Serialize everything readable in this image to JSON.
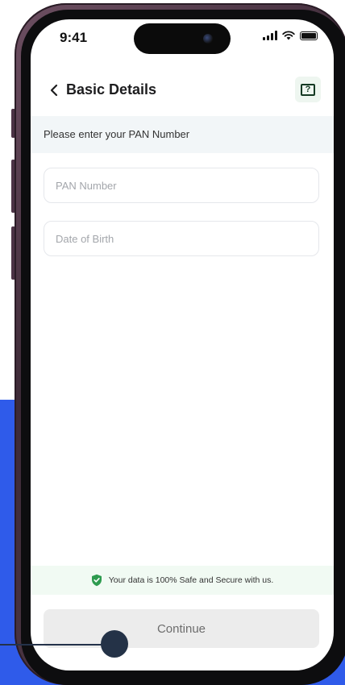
{
  "status_bar": {
    "time": "9:41"
  },
  "header": {
    "title": "Basic Details"
  },
  "form": {
    "subheading": "Please enter your PAN Number",
    "pan": {
      "placeholder": "PAN Number",
      "value": ""
    },
    "dob": {
      "placeholder": "Date of Birth",
      "value": ""
    }
  },
  "security_note": "Your data is 100% Safe and Secure with us.",
  "continue_label": "Continue",
  "colors": {
    "background_accent": "#2f5bea",
    "device_frame": "#4b3345",
    "pointer": "#243247",
    "secure_green": "#2e9b4f",
    "button_disabled": "#ececec"
  },
  "icons": [
    "back-chevron-icon",
    "help-icon",
    "signal-icon",
    "wifi-icon",
    "battery-icon",
    "shield-check-icon"
  ]
}
